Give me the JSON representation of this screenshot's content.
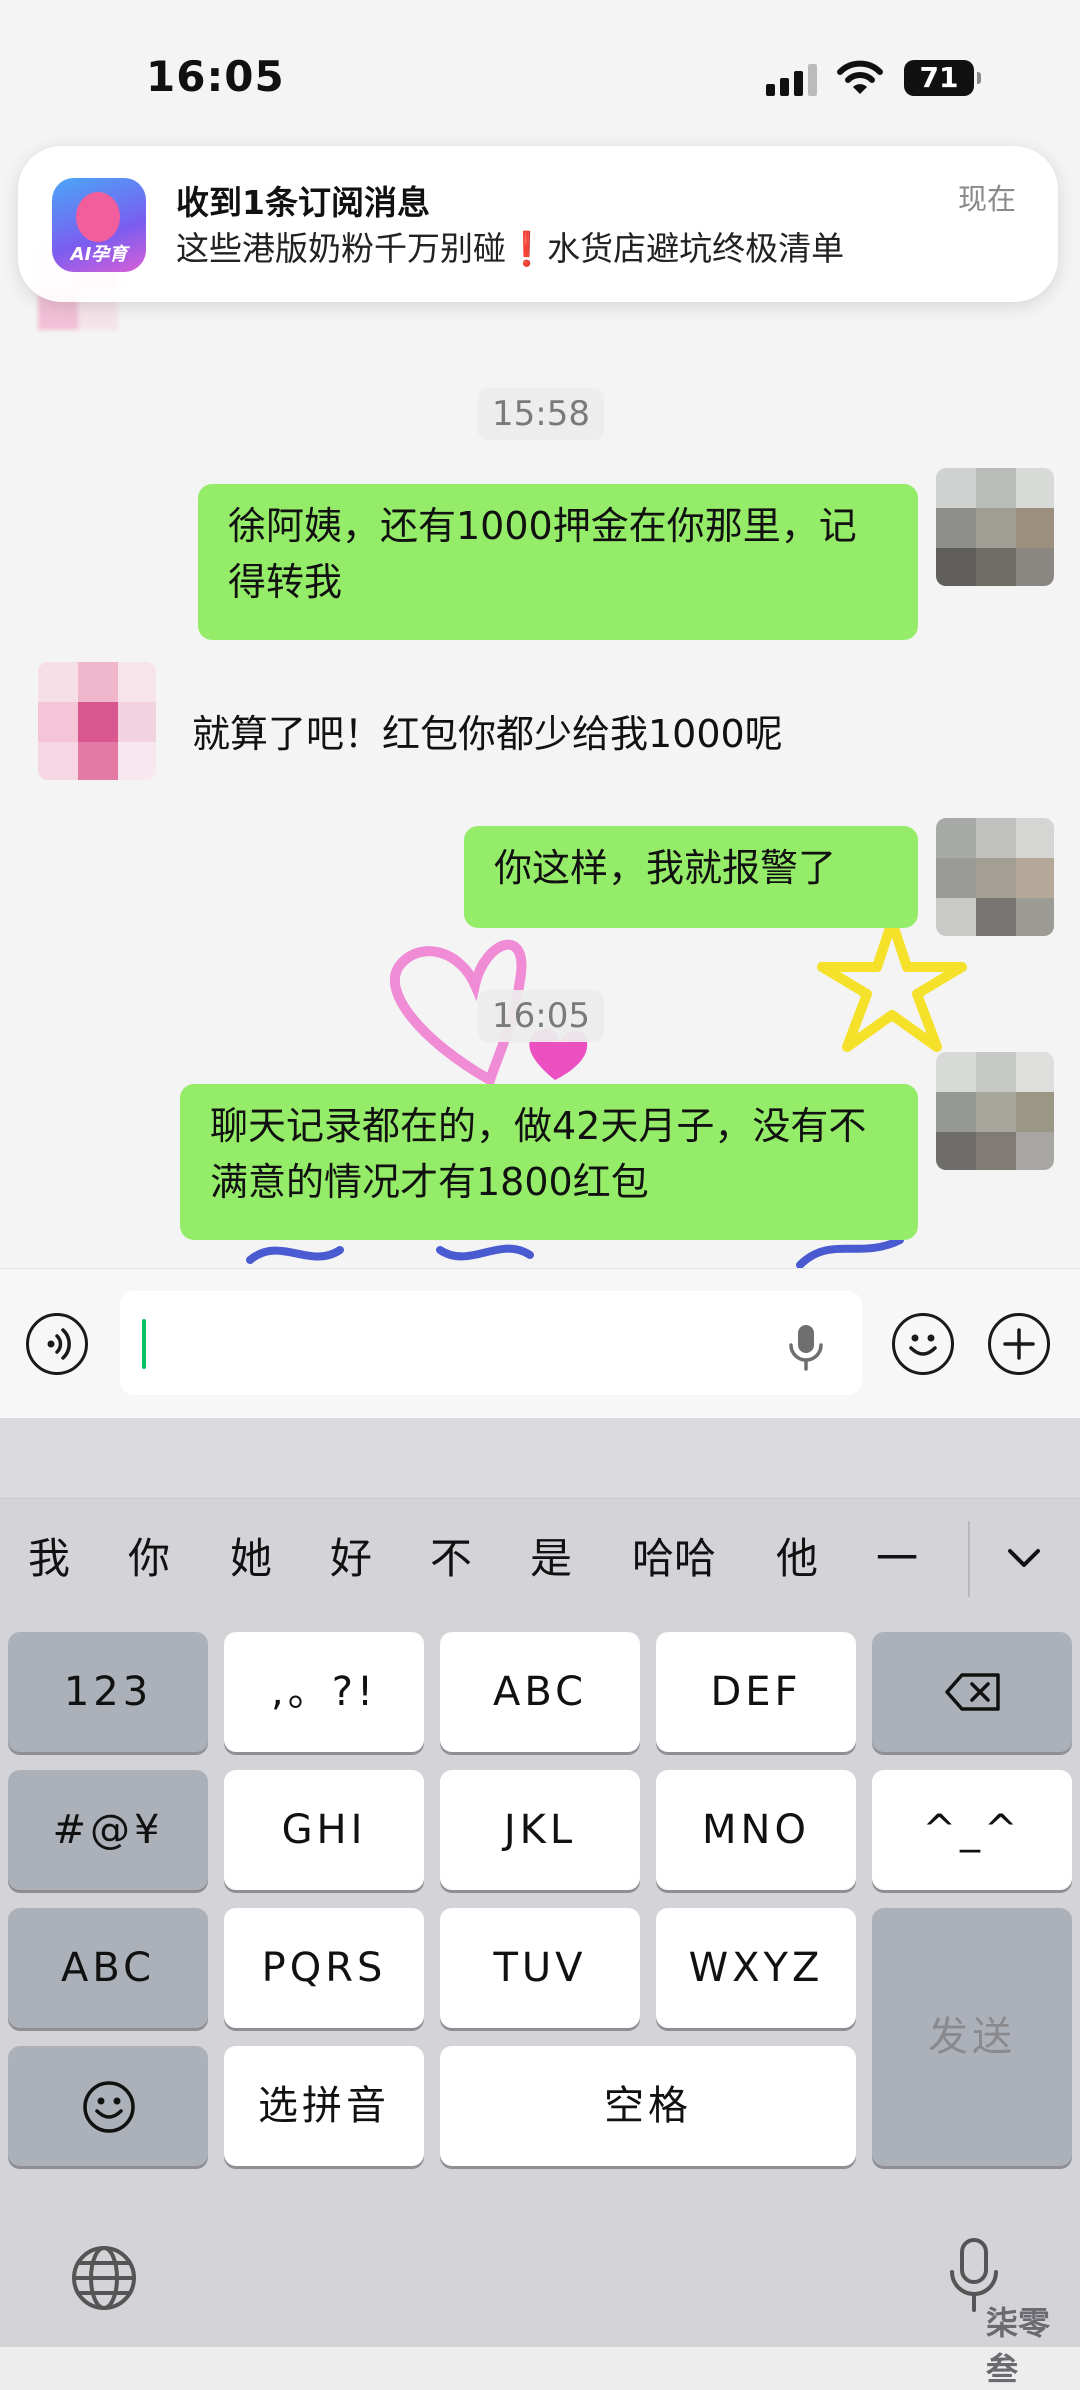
{
  "status_bar": {
    "time": "16:05",
    "battery": "71"
  },
  "notification": {
    "app_badge": "AI孕育",
    "title": "收到1条订阅消息",
    "body_before": "这些港版奶粉千万别碰",
    "body_mark": "❗",
    "body_after": "水货店避坑终极清单",
    "time": "现在"
  },
  "chat": {
    "timestamp_1": "15:58",
    "msg_1": "徐阿姨，还有1000押金在你那里，记得转我",
    "msg_2": "就算了吧！红包你都少给我1000呢",
    "msg_3": "你这样，我就报警了",
    "timestamp_2": "16:05",
    "msg_4": "聊天记录都在的，做42天月子，没有不满意的情况才有1800红包"
  },
  "keyboard": {
    "candidates": [
      "我",
      "你",
      "她",
      "好",
      "不",
      "是",
      "哈哈",
      "他",
      "一"
    ],
    "rows": [
      [
        "123",
        ",。?!",
        "ABC",
        "DEF"
      ],
      [
        "#@¥",
        "GHI",
        "JKL",
        "MNO",
        "^_^"
      ],
      [
        "ABC",
        "PQRS",
        "TUV",
        "WXYZ"
      ],
      [
        "选拼音",
        "空格"
      ]
    ],
    "send": "发送"
  },
  "watermark": "柒零叁",
  "colors": {
    "my_bubble": "#95ec69",
    "caret": "#07c160",
    "keyboard_bg": "#d3d3d8"
  }
}
